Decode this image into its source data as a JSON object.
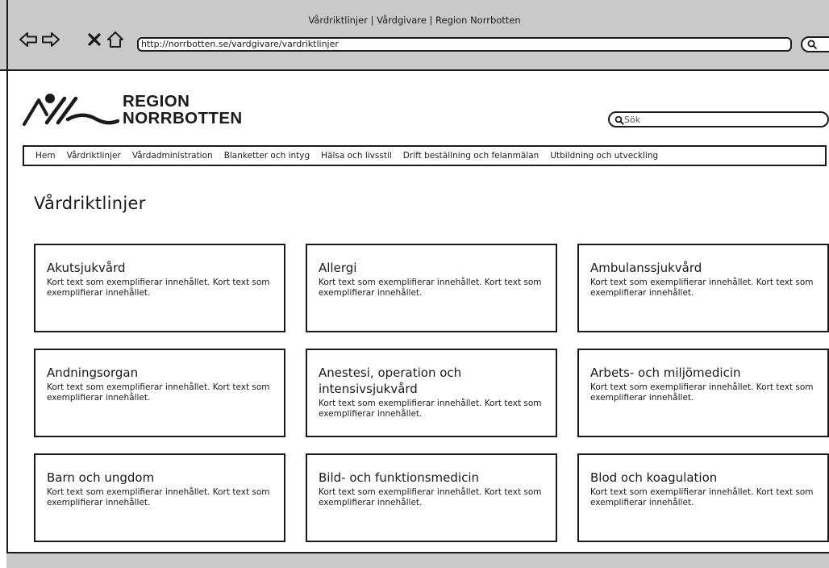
{
  "browser": {
    "window_title": "Vårdriktlinjer | Vårdgivare | Region Norrbotten",
    "url": "http://norrbotten.se/vardgivare/vardriktlinjer"
  },
  "site": {
    "logo_line1": "REGION",
    "logo_line2": "NORRBOTTEN",
    "search_placeholder": "Sök"
  },
  "nav": [
    "Hem",
    "Vårdriktlinjer",
    "Vårdadministration",
    "Blanketter och intyg",
    "Hälsa och livsstil",
    "Drift beställning och felanmälan",
    "Utbildning och utveckling"
  ],
  "page_title": "Vårdriktlinjer",
  "cards": [
    {
      "title": "Akutsjukvård",
      "text": "Kort text som exemplifierar innehållet. Kort text som exemplifierar innehållet."
    },
    {
      "title": "Allergi",
      "text": "Kort text som exemplifierar innehållet. Kort text som exemplifierar innehållet."
    },
    {
      "title": "Ambulanssjukvård",
      "text": "Kort text som exemplifierar innehållet. Kort text som exemplifierar innehållet."
    },
    {
      "title": "Andningsorgan",
      "text": "Kort text som exemplifierar innehållet. Kort text som exemplifierar innehållet."
    },
    {
      "title": "Anestesi, operation och intensivsjukvård",
      "text": "Kort text som exemplifierar innehållet. Kort text som exemplifierar innehållet."
    },
    {
      "title": "Arbets- och miljömedicin",
      "text": "Kort text som exemplifierar innehållet. Kort text som exemplifierar innehållet."
    },
    {
      "title": "Barn och ungdom",
      "text": "Kort text som exemplifierar innehållet. Kort text som exemplifierar innehållet."
    },
    {
      "title": "Bild- och funktionsmedicin",
      "text": "Kort text som exemplifierar innehållet. Kort text som exemplifierar innehållet."
    },
    {
      "title": "Blod och koagulation",
      "text": "Kort text som exemplifierar innehållet. Kort text som exemplifierar innehållet."
    }
  ]
}
